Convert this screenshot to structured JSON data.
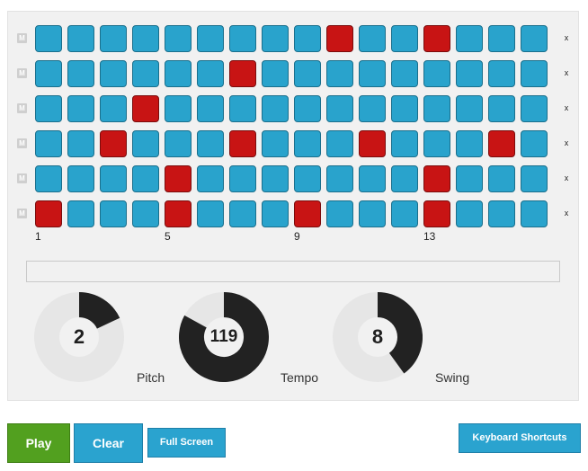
{
  "sequencer": {
    "mute_label": "M",
    "remove_label": "x",
    "steps_per_row": 16,
    "beat_markers": [
      "1",
      "5",
      "9",
      "13"
    ],
    "colors": {
      "step_off": "#29a3cc",
      "step_on": "#c81414"
    },
    "rows": [
      {
        "active_steps": [
          10,
          13
        ]
      },
      {
        "active_steps": [
          7
        ]
      },
      {
        "active_steps": [
          4
        ]
      },
      {
        "active_steps": [
          3,
          7,
          11,
          15
        ]
      },
      {
        "active_steps": [
          5,
          13
        ]
      },
      {
        "active_steps": [
          1,
          5,
          9,
          13
        ]
      }
    ]
  },
  "knobs": [
    {
      "name": "pitch",
      "value": "2",
      "label": "Pitch",
      "fill_fraction": 0.18
    },
    {
      "name": "tempo",
      "value": "119",
      "label": "Tempo",
      "fill_fraction": 0.83
    },
    {
      "name": "swing",
      "value": "8",
      "label": "Swing",
      "fill_fraction": 0.4
    }
  ],
  "controls": {
    "play_label": "Play",
    "clear_label": "Clear",
    "fullscreen_label": "Full Screen",
    "shortcuts_label": "Keyboard Shortcuts"
  }
}
